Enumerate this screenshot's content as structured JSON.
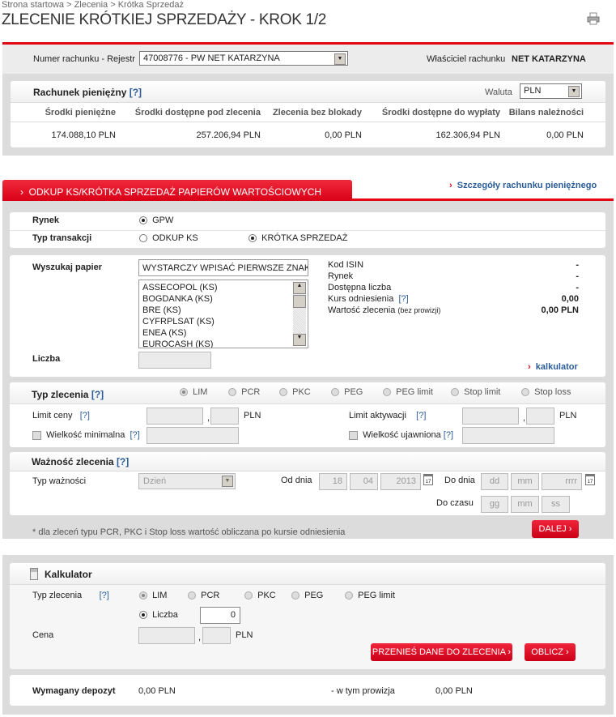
{
  "breadcrumb": "Strona startowa > Zlecenia > Krótka Sprzedaż",
  "title": "ZLECENIE KRÓTKIEJ SPRZEDAŻY - KROK 1/2",
  "account": {
    "label": "Numer rachunku - Rejestr",
    "value": "47008776 - PW NET KATARZYNA",
    "owner_label": "Właściciel rachunku",
    "owner": "NET KATARZYNA"
  },
  "cash": {
    "title": "Rachunek pieniężny",
    "help": "[?]",
    "currency_label": "Waluta",
    "currency": "PLN",
    "columns": [
      "Środki pieniężne",
      "Środki dostępne pod zlecenia",
      "Zlecenia bez blokady",
      "Środki dostępne do wypłaty",
      "Bilans należności"
    ],
    "values": [
      "174.088,10  PLN",
      "257.206,94  PLN",
      "0,00  PLN",
      "162.306,94  PLN",
      "0,00  PLN"
    ]
  },
  "tab": {
    "label": "ODKUP KS/KRÓTKA SPRZEDAŻ PAPIERÓW WARTOŚCIOWYCH",
    "link": "Szczegóły rachunku pieniężnego"
  },
  "market": {
    "label": "Rynek",
    "option": "GPW",
    "type_label": "Typ transakcji",
    "types": [
      "ODKUP KS",
      "KRÓTKA SPRZEDAŻ"
    ],
    "selected_type": 1
  },
  "search": {
    "label": "Wyszukaj papier",
    "value": "WYSTARCZY WPISAĆ PIERWSZE ZNAKI",
    "list": [
      "ASSECOPOL (KS)",
      "BOGDANKA (KS)",
      "BRE (KS)",
      "CYFRPLSAT (KS)",
      "ENEA (KS)",
      "EUROCASH (KS)"
    ],
    "qty_label": "Liczba",
    "info": [
      {
        "label": "Kod ISIN",
        "value": "-"
      },
      {
        "label": "Rynek",
        "value": "-"
      },
      {
        "label": "Dostępna liczba",
        "value": "-"
      },
      {
        "label": "Kurs odniesienia",
        "help": "[?]",
        "value": "0,00"
      },
      {
        "label": "Wartość zlecenia",
        "note": "(bez prowizji)",
        "value": "0,00 PLN"
      }
    ],
    "calc_link": "kalkulator"
  },
  "order_type": {
    "label": "Typ zlecenia",
    "help": "[?]",
    "options": [
      "LIM",
      "PCR",
      "PKC",
      "PEG",
      "PEG limit",
      "Stop limit",
      "Stop loss"
    ],
    "selected": 0,
    "limit_label": "Limit ceny",
    "activation_label": "Limit aktywacji",
    "currency": "PLN",
    "min_label": "Wielkość minimalna",
    "visible_label": "Wielkość ujawniona",
    "comma": ","
  },
  "validity": {
    "label": "Ważność zlecenia",
    "help": "[?]",
    "type_label": "Typ ważności",
    "type": "Dzień",
    "from_label": "Od dnia",
    "from": [
      "18",
      "04",
      "2013"
    ],
    "to_label": "Do dnia",
    "to_ph": [
      "dd",
      "mm",
      "rrrr"
    ],
    "time_label": "Do czasu",
    "time_ph": [
      "gg",
      "mm",
      "ss"
    ],
    "cal": "17"
  },
  "footnote": "* dla zleceń typu PCR, PKC i Stop loss wartość obliczana po kursie odniesienia",
  "next_button": "DALEJ ›",
  "calculator": {
    "title": "Kalkulator",
    "type_label": "Typ zlecenia",
    "help": "[?]",
    "options": [
      "LIM",
      "PCR",
      "PKC",
      "PEG",
      "PEG limit"
    ],
    "qty_label": "Liczba",
    "qty": "0",
    "price_label": "Cena",
    "currency": "PLN",
    "comma": ",",
    "transfer_button": "PRZENIEŚ DANE DO ZLECENIA ›",
    "calc_button": "OBLICZ ›"
  },
  "result": {
    "deposit_label": "Wymagany depozyt",
    "deposit": "0,00  PLN",
    "commission_label": "- w tym prowizja",
    "commission": "0,00  PLN"
  },
  "colors": {
    "accent": "#e30613",
    "link": "#2a5c99"
  }
}
